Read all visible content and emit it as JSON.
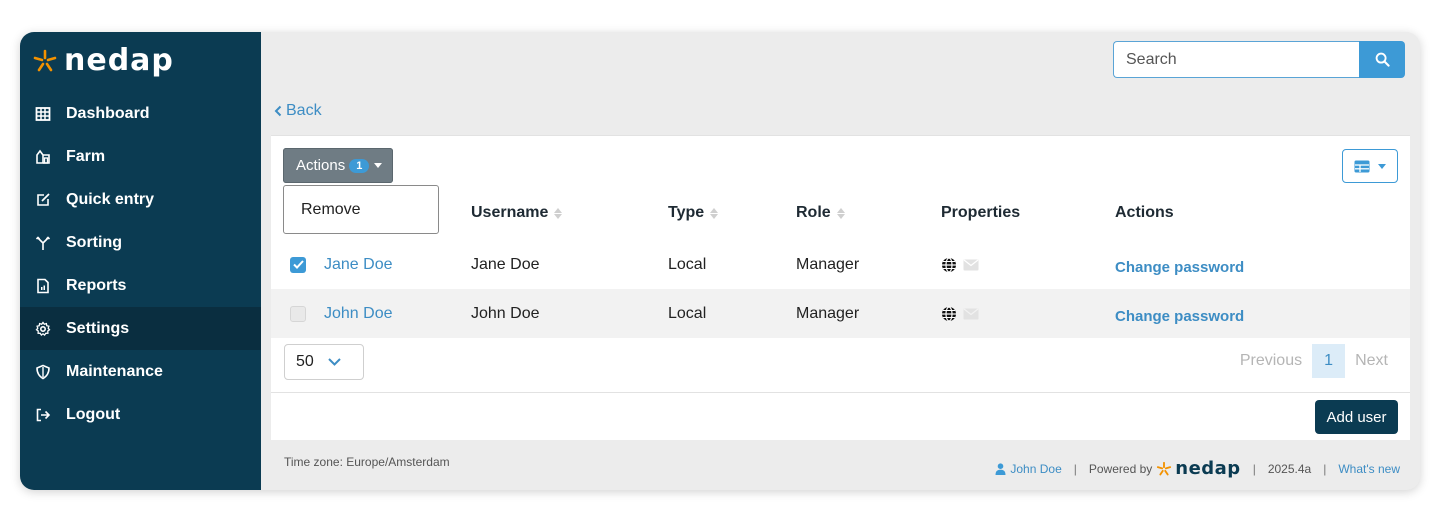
{
  "app": {
    "logo_text": "nedap"
  },
  "colors": {
    "sidebar": "#0b3b52",
    "accent": "#3d9ad6",
    "logo_star": "#f39200"
  },
  "sidebar": {
    "items": [
      {
        "label": "Dashboard",
        "icon": "grid-icon"
      },
      {
        "label": "Farm",
        "icon": "farm-icon"
      },
      {
        "label": "Quick entry",
        "icon": "edit-icon"
      },
      {
        "label": "Sorting",
        "icon": "sorting-icon"
      },
      {
        "label": "Reports",
        "icon": "report-icon"
      },
      {
        "label": "Settings",
        "icon": "gear-icon",
        "active": true
      },
      {
        "label": "Maintenance",
        "icon": "shield-icon"
      },
      {
        "label": "Logout",
        "icon": "logout-icon"
      }
    ]
  },
  "search": {
    "placeholder": "Search",
    "button_icon": "search-icon"
  },
  "nav": {
    "back_label": "Back"
  },
  "toolbar": {
    "actions_label": "Actions",
    "actions_count": "1",
    "dropdown_item": "Remove",
    "view_toggle_icon": "table-view-icon"
  },
  "table": {
    "columns": [
      "Username",
      "Type",
      "Role",
      "Properties",
      "Actions"
    ],
    "rows": [
      {
        "checked": true,
        "name": "Jane Doe",
        "username": "Jane Doe",
        "type": "Local",
        "role": "Manager",
        "action": "Change password"
      },
      {
        "checked": false,
        "name": "John Doe",
        "username": "John Doe",
        "type": "Local",
        "role": "Manager",
        "action": "Change password"
      }
    ]
  },
  "pagination": {
    "per_page": "50",
    "previous": "Previous",
    "current": "1",
    "next": "Next"
  },
  "add_user_label": "Add user",
  "footer": {
    "timezone": "Time zone: Europe/Amsterdam",
    "user": "John Doe",
    "powered_by": "Powered by",
    "logo_text": "nedap",
    "version": "2025.4a",
    "whats_new": "What's new",
    "sep": "|"
  }
}
